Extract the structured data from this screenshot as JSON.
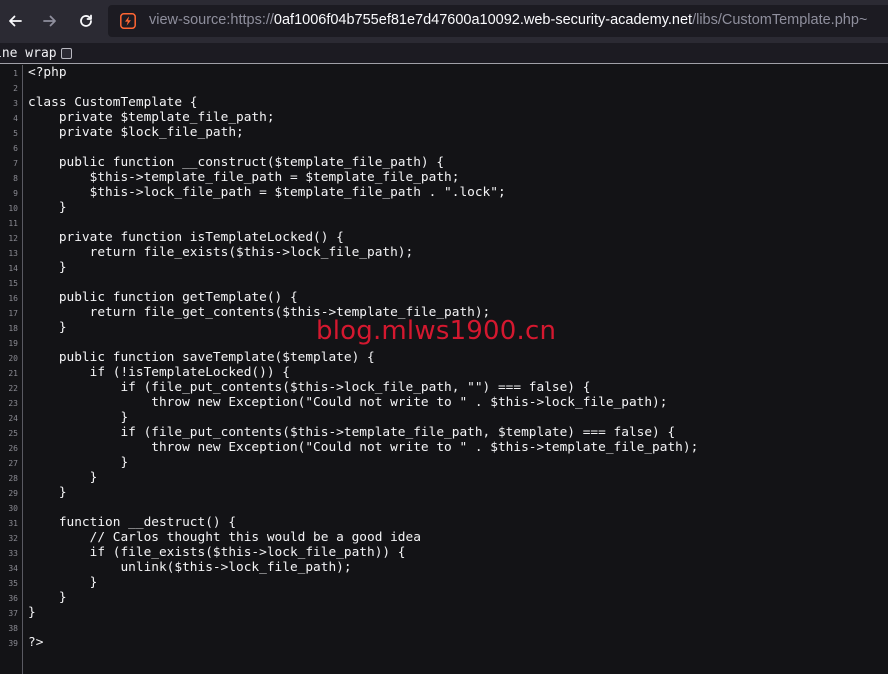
{
  "browser": {
    "url_prefix": "view-source:https://",
    "url_host": "0af1006f04b755ef81e7d47600a10092.web-security-academy.net",
    "url_path": "/libs/CustomTemplate.php~",
    "back_icon": "arrow-left-icon",
    "forward_icon": "arrow-right-icon",
    "reload_icon": "reload-icon",
    "site_icon": "burp-lightning-icon",
    "accent": "#ff6633"
  },
  "viewer": {
    "line_wrap_label": "ine wrap",
    "line_wrap_checked": false
  },
  "source": {
    "lines": [
      {
        "n": "1",
        "text": "<?php"
      },
      {
        "n": "2",
        "text": ""
      },
      {
        "n": "3",
        "text": "class CustomTemplate {"
      },
      {
        "n": "4",
        "text": "    private $template_file_path;"
      },
      {
        "n": "5",
        "text": "    private $lock_file_path;"
      },
      {
        "n": "6",
        "text": ""
      },
      {
        "n": "7",
        "text": "    public function __construct($template_file_path) {"
      },
      {
        "n": "8",
        "text": "        $this->template_file_path = $template_file_path;"
      },
      {
        "n": "9",
        "text": "        $this->lock_file_path = $template_file_path . \".lock\";"
      },
      {
        "n": "10",
        "text": "    }"
      },
      {
        "n": "11",
        "text": ""
      },
      {
        "n": "12",
        "text": "    private function isTemplateLocked() {"
      },
      {
        "n": "13",
        "text": "        return file_exists($this->lock_file_path);"
      },
      {
        "n": "14",
        "text": "    }"
      },
      {
        "n": "15",
        "text": ""
      },
      {
        "n": "16",
        "text": "    public function getTemplate() {"
      },
      {
        "n": "17",
        "text": "        return file_get_contents($this->template_file_path);"
      },
      {
        "n": "18",
        "text": "    }"
      },
      {
        "n": "19",
        "text": ""
      },
      {
        "n": "20",
        "text": "    public function saveTemplate($template) {"
      },
      {
        "n": "21",
        "text": "        if (!isTemplateLocked()) {"
      },
      {
        "n": "22",
        "text": "            if (file_put_contents($this->lock_file_path, \"\") === false) {"
      },
      {
        "n": "23",
        "text": "                throw new Exception(\"Could not write to \" . $this->lock_file_path);"
      },
      {
        "n": "24",
        "text": "            }"
      },
      {
        "n": "25",
        "text": "            if (file_put_contents($this->template_file_path, $template) === false) {"
      },
      {
        "n": "26",
        "text": "                throw new Exception(\"Could not write to \" . $this->template_file_path);"
      },
      {
        "n": "27",
        "text": "            }"
      },
      {
        "n": "28",
        "text": "        }"
      },
      {
        "n": "29",
        "text": "    }"
      },
      {
        "n": "30",
        "text": ""
      },
      {
        "n": "31",
        "text": "    function __destruct() {"
      },
      {
        "n": "32",
        "text": "        // Carlos thought this would be a good idea"
      },
      {
        "n": "33",
        "text": "        if (file_exists($this->lock_file_path)) {"
      },
      {
        "n": "34",
        "text": "            unlink($this->lock_file_path);"
      },
      {
        "n": "35",
        "text": "        }"
      },
      {
        "n": "36",
        "text": "    }"
      },
      {
        "n": "37",
        "text": "}"
      },
      {
        "n": "38",
        "text": ""
      },
      {
        "n": "39",
        "text": "?>"
      }
    ]
  },
  "watermark": {
    "text": "blog.mlws1900.cn",
    "color": "#d4182f"
  }
}
